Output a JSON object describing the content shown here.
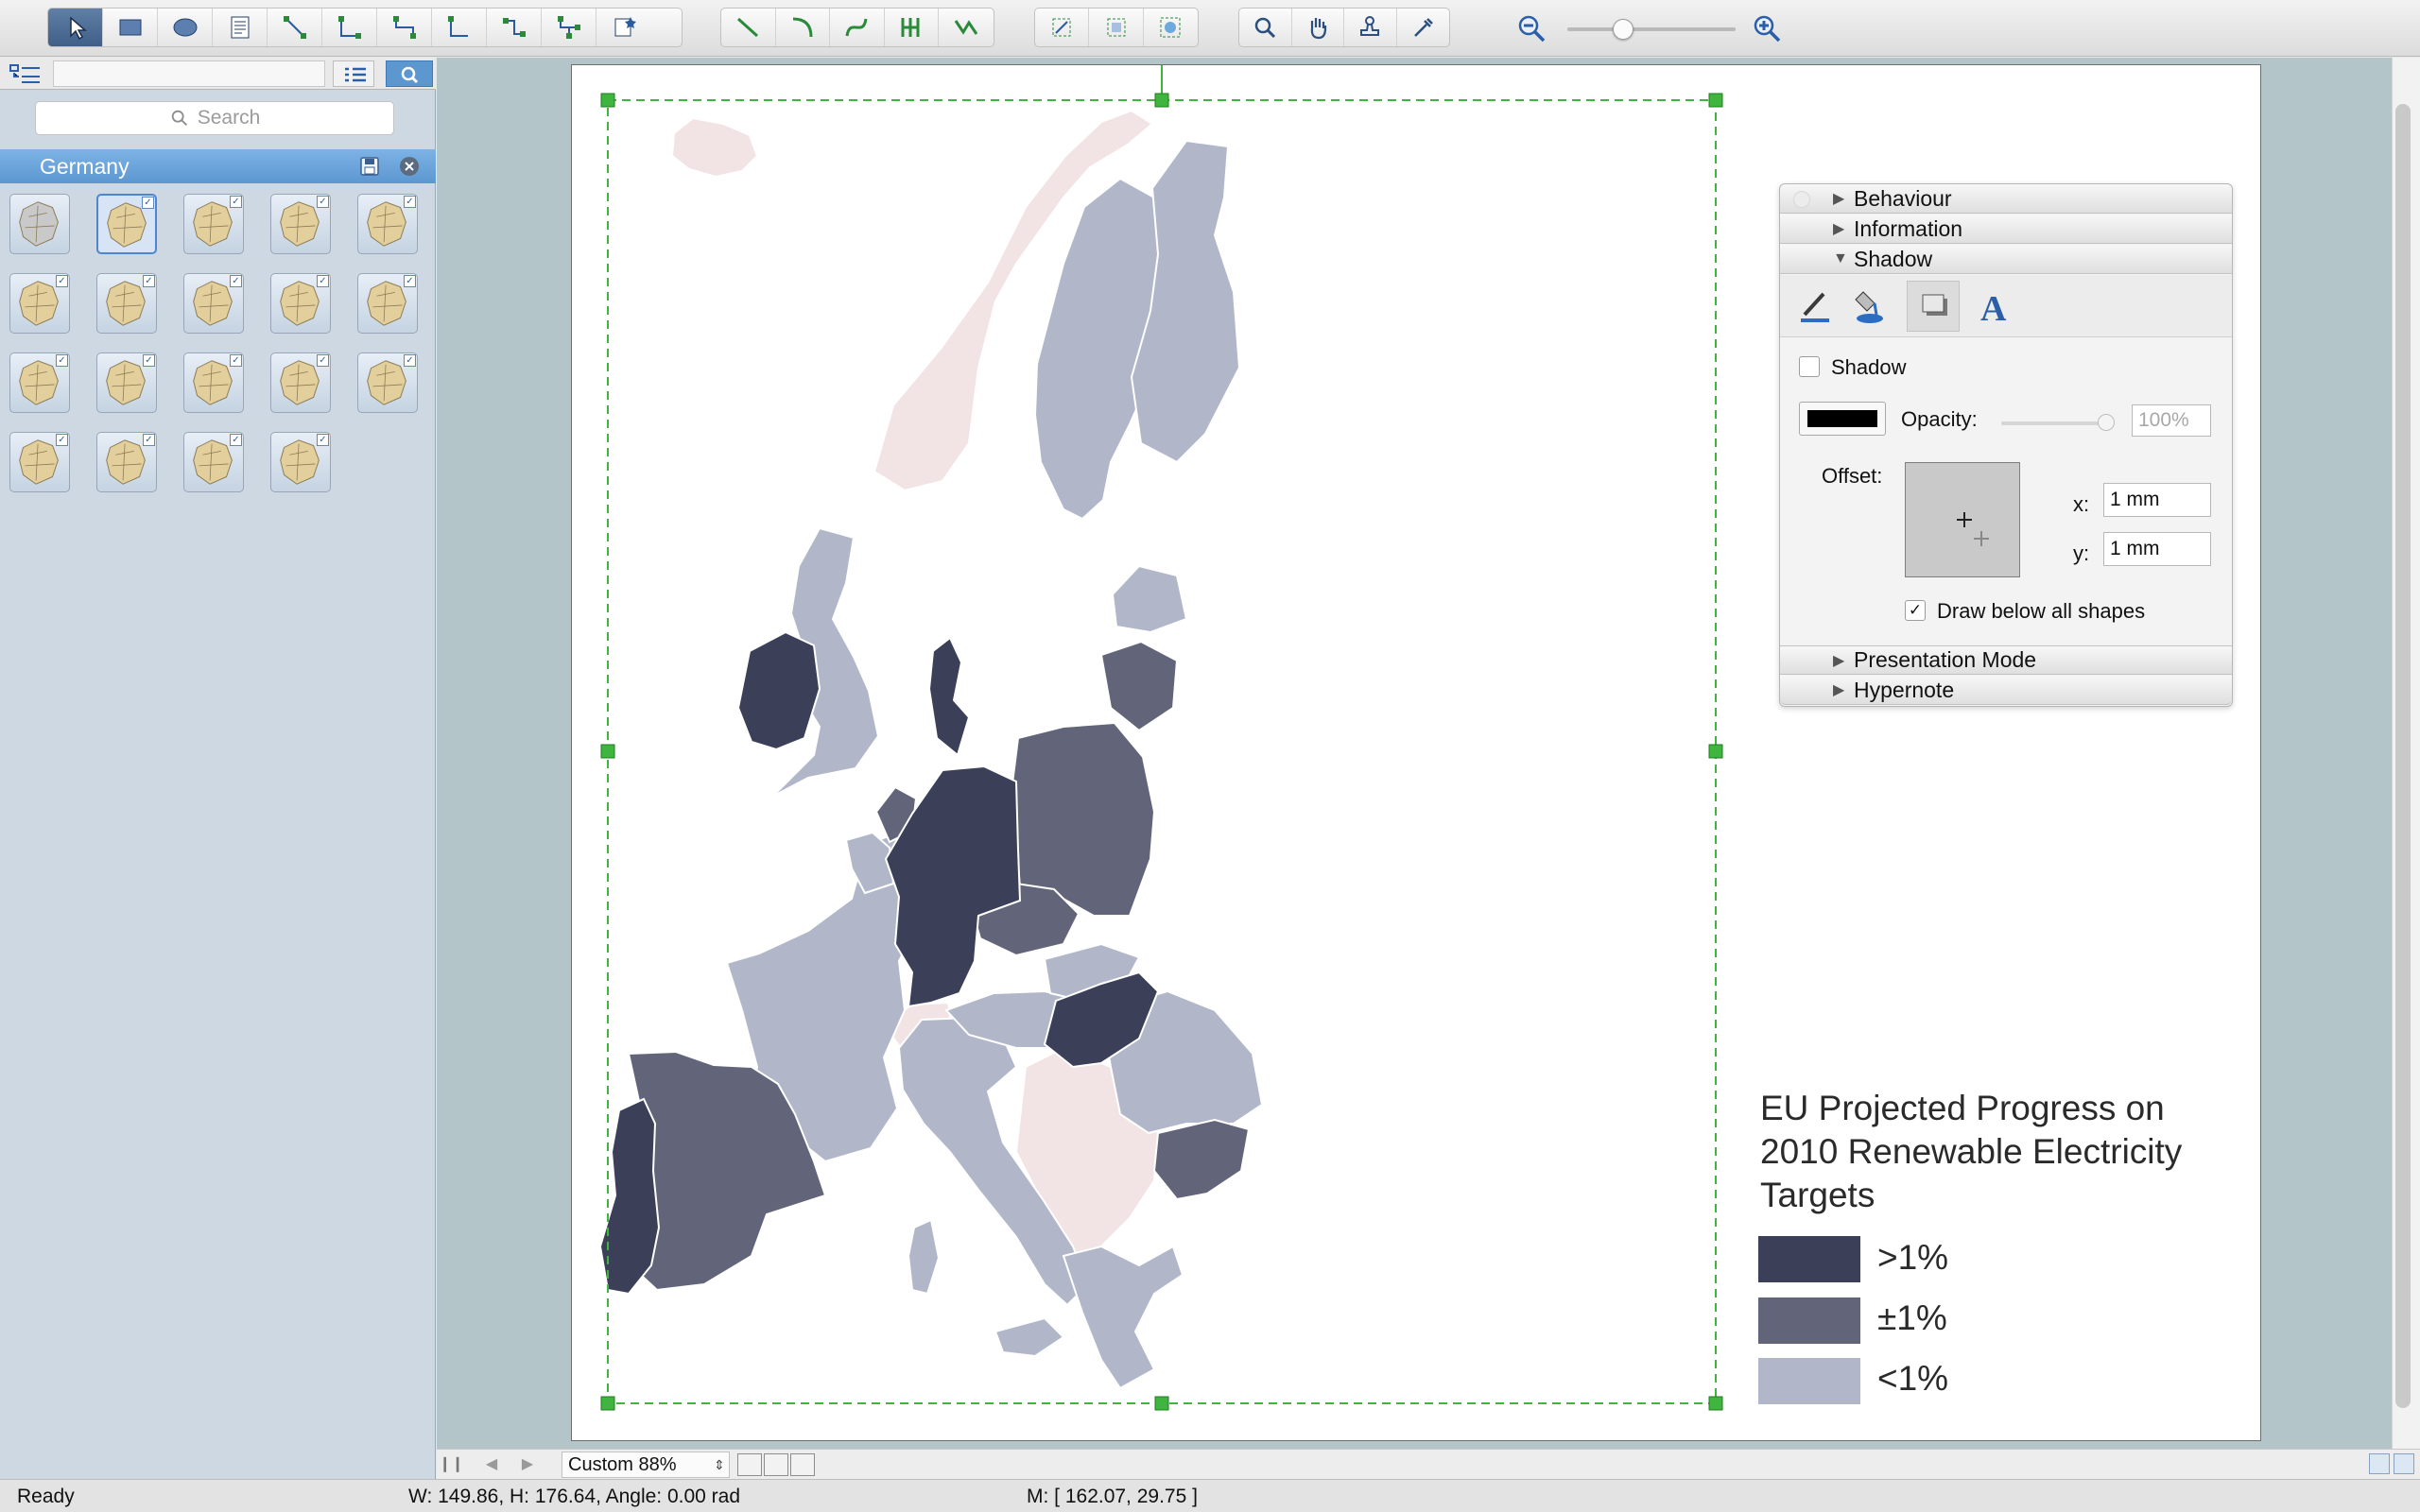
{
  "toolbar": {
    "tools": [
      "pointer",
      "rectangle",
      "ellipse",
      "text-block",
      "connector-direct",
      "connector-smart",
      "connector-tree",
      "connector-curved",
      "connector-org",
      "connector-layout",
      "insert-shape",
      "line",
      "arc",
      "bezier",
      "chain",
      "rotate",
      "spline",
      "group-shapes",
      "ungroup",
      "zoom",
      "hand",
      "stamp",
      "eyedropper"
    ],
    "zoom_out_icon": "zoom-out-icon",
    "zoom_in_icon": "zoom-in-icon",
    "zoom_slider_fraction": 0.33
  },
  "library": {
    "search_placeholder": "Search",
    "group_title": "Germany",
    "thumbnail_count": 19,
    "selected_index": 1
  },
  "inspector": {
    "sections": {
      "behaviour": "Behaviour",
      "information": "Information",
      "shadow": "Shadow",
      "presentation_mode": "Presentation Mode",
      "hypernote": "Hypernote"
    },
    "shadow_checkbox_label": "Shadow",
    "shadow_checked": false,
    "shadow_color": "#000000",
    "opacity_label": "Opacity:",
    "opacity_value": "100%",
    "offset_label": "Offset:",
    "x_label": "x:",
    "x_value": "1 mm",
    "y_label": "y:",
    "y_value": "1 mm",
    "draw_below_label": "Draw below all shapes",
    "draw_below_checked": true
  },
  "map": {
    "title": "EU Projected Progress on 2010 Renewable Electricity Targets",
    "title_lines": [
      "EU Projected Progress on",
      "2010 Renewable Electricity",
      "Targets"
    ],
    "legend": [
      {
        "label": ">1%",
        "color": "#3b3f58"
      },
      {
        "label": "±1%",
        "color": "#626579"
      },
      {
        "label": "<1%",
        "color": "#b1b7c9"
      }
    ],
    "no_data_color": "#f2e3e4",
    "selection_color": "#3fb53f"
  },
  "canvasbar": {
    "zoom_label": "Custom 88%"
  },
  "status": {
    "ready": "Ready",
    "dims": "W: 149.86,  H: 176.64,  Angle: 0.00 rad",
    "mouse": "M: [ 162.07, 29.75 ]"
  }
}
